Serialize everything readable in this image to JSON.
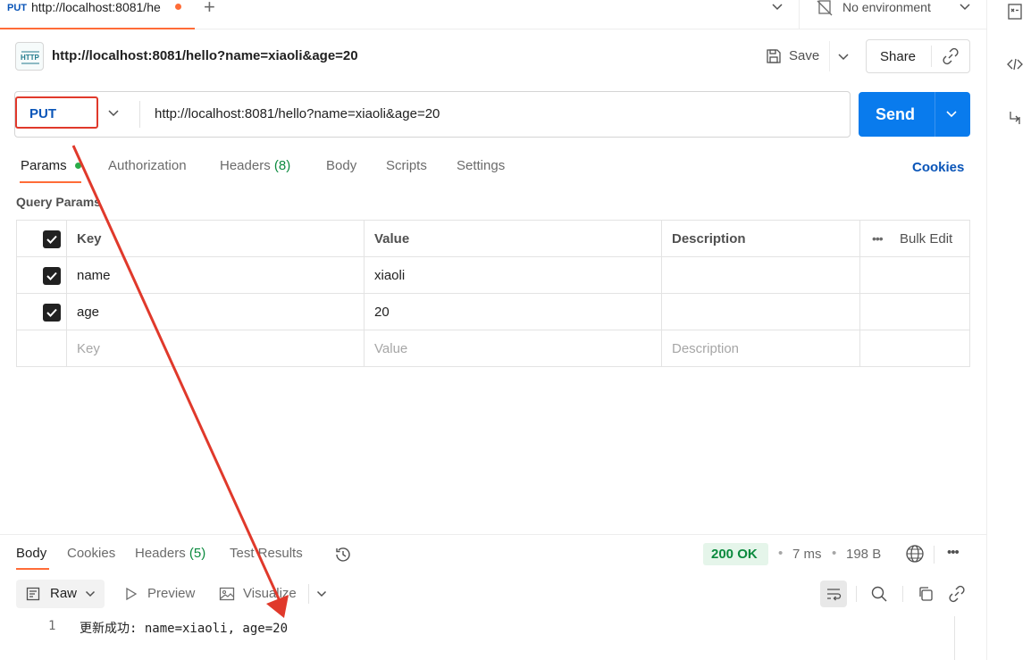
{
  "tab": {
    "method": "PUT",
    "url": "http://localhost:8081/he"
  },
  "environment": {
    "label": "No environment"
  },
  "request": {
    "title": "http://localhost:8081/hello?name=xiaoli&age=20",
    "save_label": "Save",
    "share_label": "Share",
    "method": "PUT",
    "url": "http://localhost:8081/hello?name=xiaoli&age=20",
    "send_label": "Send"
  },
  "request_tabs": {
    "params": "Params",
    "authorization": "Authorization",
    "headers": "Headers",
    "headers_count": "(8)",
    "body": "Body",
    "scripts": "Scripts",
    "settings": "Settings",
    "cookies": "Cookies"
  },
  "query_params": {
    "title": "Query Params",
    "columns": {
      "key": "Key",
      "value": "Value",
      "description": "Description",
      "bulk_edit": "Bulk Edit"
    },
    "rows": [
      {
        "key": "name",
        "value": "xiaoli",
        "description": "",
        "checked": true
      },
      {
        "key": "age",
        "value": "20",
        "description": "",
        "checked": true
      }
    ],
    "placeholder": {
      "key": "Key",
      "value": "Value",
      "description": "Description"
    }
  },
  "response": {
    "tabs": {
      "body": "Body",
      "cookies": "Cookies",
      "headers": "Headers",
      "headers_count": "(5)",
      "test_results": "Test Results"
    },
    "status": "200 OK",
    "time": "7 ms",
    "size": "198 B",
    "format": {
      "raw": "Raw",
      "preview": "Preview",
      "visualize": "Visualize"
    },
    "line_number": "1",
    "body_text": "更新成功: name=xiaoli, age=20"
  },
  "colors": {
    "accent": "#ff6c37",
    "send": "#097bed",
    "method": "#0a55b8",
    "annotation": "#e0392b",
    "success": "#0b8a3e"
  }
}
